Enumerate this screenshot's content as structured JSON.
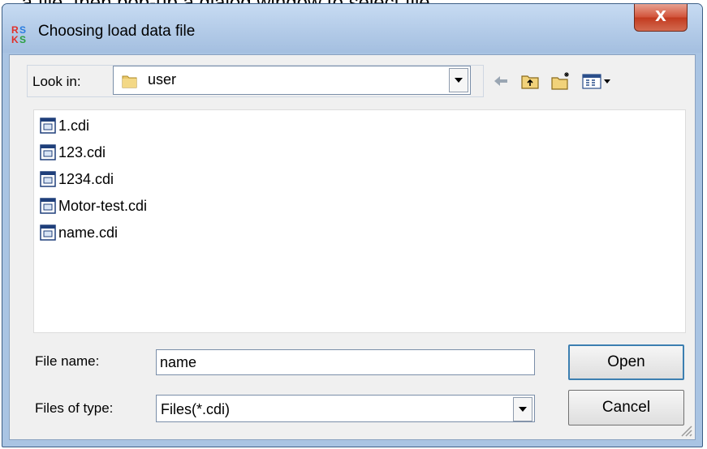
{
  "caption": "... a file, then pop-up a dialog window to select file.",
  "dialog": {
    "title": "Choosing load data file",
    "close_label": "X"
  },
  "look_in": {
    "label": "Look in:",
    "value": "user"
  },
  "toolbar": {
    "icons": [
      "back-arrow-icon",
      "up-one-level-icon",
      "create-new-folder-icon",
      "view-menu-icon"
    ]
  },
  "files": [
    {
      "name": "1.cdi"
    },
    {
      "name": "123.cdi"
    },
    {
      "name": "1234.cdi"
    },
    {
      "name": "Motor-test.cdi"
    },
    {
      "name": "name.cdi"
    }
  ],
  "file_name": {
    "label": "File name:",
    "value": "name"
  },
  "file_type": {
    "label": "Files of type:",
    "value": "Files(*.cdi)"
  },
  "buttons": {
    "open": "Open",
    "cancel": "Cancel"
  },
  "colors": {
    "titlebar": "#b3cbe8",
    "close_button": "#c23b20",
    "client_bg": "#f0f0f0"
  }
}
